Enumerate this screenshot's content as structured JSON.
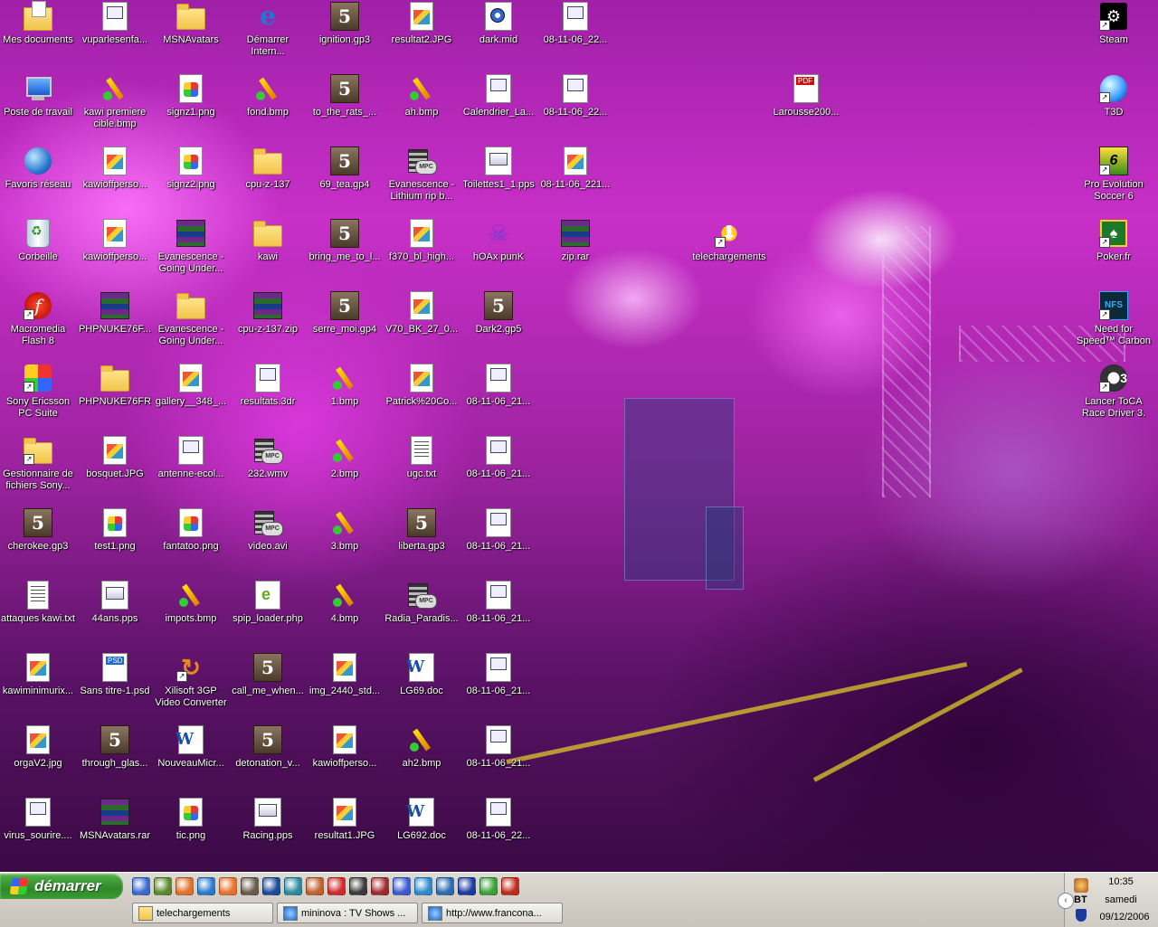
{
  "desktop": {
    "icons": [
      {
        "label": "Mes documents",
        "icon": "my-documents-icon",
        "kind": "mydocs"
      },
      {
        "label": "Poste de travail",
        "icon": "my-computer-icon",
        "kind": "computer"
      },
      {
        "label": "Favoris réseau",
        "icon": "network-places-icon",
        "kind": "network"
      },
      {
        "label": "Corbeille",
        "icon": "recycle-bin-icon",
        "kind": "bin"
      },
      {
        "label": "Macromedia Flash 8",
        "icon": "flash-icon",
        "kind": "flash",
        "shortcut": true
      },
      {
        "label": "Sony Ericsson PC Suite",
        "icon": "sony-ericsson-icon",
        "kind": "sonyeric",
        "shortcut": true
      },
      {
        "label": "Gestionnaire de fichiers Sony...",
        "icon": "folder-icon",
        "kind": "folder",
        "shortcut": true
      },
      {
        "label": "cherokee.gp3",
        "icon": "guitar-pro-icon",
        "kind": "gp3"
      },
      {
        "label": "attaques kawi.txt",
        "icon": "text-file-icon",
        "kind": "txt"
      },
      {
        "label": "kawiminimurix...",
        "icon": "image-file-icon",
        "kind": "img"
      },
      {
        "label": "orgaV2.jpg",
        "icon": "image-file-icon",
        "kind": "img"
      },
      {
        "label": "virus_sourire....",
        "icon": "web-file-icon",
        "kind": "web"
      },
      {
        "label": "vuparlesenfa...",
        "icon": "web-file-icon",
        "kind": "web"
      },
      {
        "label": "kawi premiere cible.bmp",
        "icon": "bitmap-icon",
        "kind": "bmp"
      },
      {
        "label": "kawioffperso...",
        "icon": "image-file-icon",
        "kind": "img"
      },
      {
        "label": "kawioffperso...",
        "icon": "image-file-icon",
        "kind": "img"
      },
      {
        "label": "PHPNUKE76F...",
        "icon": "rar-archive-icon",
        "kind": "rar"
      },
      {
        "label": "PHPNUKE76FR",
        "icon": "folder-icon",
        "kind": "folder"
      },
      {
        "label": "bosquet.JPG",
        "icon": "image-file-icon",
        "kind": "img"
      },
      {
        "label": "test1.png",
        "icon": "png-file-icon",
        "kind": "png"
      },
      {
        "label": "44ans.pps",
        "icon": "slideshow-icon",
        "kind": "pps"
      },
      {
        "label": "Sans titre-1.psd",
        "icon": "psd-file-icon",
        "kind": "psd"
      },
      {
        "label": "through_glas...",
        "icon": "guitar-pro-icon",
        "kind": "gp3"
      },
      {
        "label": "MSNAvatars.rar",
        "icon": "rar-archive-icon",
        "kind": "rar"
      },
      {
        "label": "MSNAvatars",
        "icon": "folder-icon",
        "kind": "folder"
      },
      {
        "label": "signz1.png",
        "icon": "png-file-icon",
        "kind": "png"
      },
      {
        "label": "signz2.png",
        "icon": "png-file-icon",
        "kind": "png"
      },
      {
        "label": "Evanescence - Going Under...",
        "icon": "rar-archive-icon",
        "kind": "rar"
      },
      {
        "label": "Evanescence - Going Under...",
        "icon": "folder-icon",
        "kind": "folder"
      },
      {
        "label": "gallery__348_...",
        "icon": "image-file-icon",
        "kind": "img"
      },
      {
        "label": "antenne-ecol...",
        "icon": "web-file-icon",
        "kind": "web"
      },
      {
        "label": "fantatoo.png",
        "icon": "png-file-icon",
        "kind": "png"
      },
      {
        "label": "impots.bmp",
        "icon": "bitmap-icon",
        "kind": "bmp"
      },
      {
        "label": "Xilisoft 3GP Video Converter",
        "icon": "xilisoft-icon",
        "kind": "xili",
        "shortcut": true
      },
      {
        "label": "NouveauMicr...",
        "icon": "word-document-icon",
        "kind": "word"
      },
      {
        "label": "tic.png",
        "icon": "png-file-icon",
        "kind": "png"
      },
      {
        "label": "Démarrer Intern...",
        "icon": "internet-explorer-icon",
        "kind": "ie"
      },
      {
        "label": "fond.bmp",
        "icon": "bitmap-icon",
        "kind": "bmp"
      },
      {
        "label": "cpu-z-137",
        "icon": "folder-icon",
        "kind": "folder"
      },
      {
        "label": "kawi",
        "icon": "folder-icon",
        "kind": "folder"
      },
      {
        "label": "cpu-z-137.zip",
        "icon": "rar-archive-icon",
        "kind": "rar"
      },
      {
        "label": "resultats.3dr",
        "icon": "web-file-icon",
        "kind": "web"
      },
      {
        "label": "232.wmv",
        "icon": "video-file-icon",
        "kind": "video"
      },
      {
        "label": "video.avi",
        "icon": "video-file-icon",
        "kind": "video"
      },
      {
        "label": "spip_loader.php",
        "icon": "php-file-icon",
        "kind": "php"
      },
      {
        "label": "call_me_when...",
        "icon": "guitar-pro-icon",
        "kind": "gp3"
      },
      {
        "label": "detonation_v...",
        "icon": "guitar-pro-icon",
        "kind": "gp3"
      },
      {
        "label": "Racing.pps",
        "icon": "slideshow-icon",
        "kind": "pps"
      },
      {
        "label": "ignition.gp3",
        "icon": "guitar-pro-icon",
        "kind": "gp3"
      },
      {
        "label": "to_the_rats_...",
        "icon": "guitar-pro-icon",
        "kind": "gp3"
      },
      {
        "label": "69_tea.gp4",
        "icon": "guitar-pro-icon",
        "kind": "gp3"
      },
      {
        "label": "bring_me_to_l...",
        "icon": "guitar-pro-icon",
        "kind": "gp3"
      },
      {
        "label": "serre_moi.gp4",
        "icon": "guitar-pro-icon",
        "kind": "gp3"
      },
      {
        "label": "1.bmp",
        "icon": "bitmap-icon",
        "kind": "bmp"
      },
      {
        "label": "2.bmp",
        "icon": "bitmap-icon",
        "kind": "bmp"
      },
      {
        "label": "3.bmp",
        "icon": "bitmap-icon",
        "kind": "bmp"
      },
      {
        "label": "4.bmp",
        "icon": "bitmap-icon",
        "kind": "bmp"
      },
      {
        "label": "img_2440_std...",
        "icon": "image-file-icon",
        "kind": "img"
      },
      {
        "label": "kawioffperso...",
        "icon": "image-file-icon",
        "kind": "img"
      },
      {
        "label": "resultat1.JPG",
        "icon": "image-file-icon",
        "kind": "img"
      },
      {
        "label": "resultat2.JPG",
        "icon": "image-file-icon",
        "kind": "img"
      },
      {
        "label": "ah.bmp",
        "icon": "bitmap-icon",
        "kind": "bmp"
      },
      {
        "label": "Evanescence - Lithium rip b...",
        "icon": "video-file-icon",
        "kind": "video"
      },
      {
        "label": "f370_bl_high...",
        "icon": "image-file-icon",
        "kind": "img"
      },
      {
        "label": "V70_BK_27_0...",
        "icon": "image-file-icon",
        "kind": "img"
      },
      {
        "label": "Patrick%20Co...",
        "icon": "image-file-icon",
        "kind": "img"
      },
      {
        "label": "ugc.txt",
        "icon": "text-file-icon",
        "kind": "txt"
      },
      {
        "label": "liberta.gp3",
        "icon": "guitar-pro-icon",
        "kind": "gp3"
      },
      {
        "label": "Radia_Paradis...",
        "icon": "video-file-icon",
        "kind": "video"
      },
      {
        "label": "LG69.doc",
        "icon": "word-document-icon",
        "kind": "word"
      },
      {
        "label": "ah2.bmp",
        "icon": "bitmap-icon",
        "kind": "bmp"
      },
      {
        "label": "LG692.doc",
        "icon": "word-document-icon",
        "kind": "word"
      },
      {
        "label": "dark.mid",
        "icon": "midi-file-icon",
        "kind": "mid"
      },
      {
        "label": "Calendrier_La...",
        "icon": "web-file-icon",
        "kind": "web"
      },
      {
        "label": "Toilettes1_1.pps",
        "icon": "slideshow-icon",
        "kind": "pps"
      },
      {
        "label": "hOAx punK",
        "icon": "spider-icon",
        "kind": "ghost"
      },
      {
        "label": "Dark2.gp5",
        "icon": "guitar-pro-icon",
        "kind": "gp3"
      },
      {
        "label": "08-11-06_21...",
        "icon": "web-page-icon",
        "kind": "web"
      },
      {
        "label": "08-11-06_21...",
        "icon": "web-page-icon",
        "kind": "web"
      },
      {
        "label": "08-11-06_21...",
        "icon": "web-page-icon",
        "kind": "web"
      },
      {
        "label": "08-11-06_21...",
        "icon": "web-page-icon",
        "kind": "web"
      },
      {
        "label": "08-11-06_21...",
        "icon": "web-page-icon",
        "kind": "web"
      },
      {
        "label": "08-11-06_21...",
        "icon": "web-page-icon",
        "kind": "web"
      },
      {
        "label": "08-11-06_22...",
        "icon": "web-page-icon",
        "kind": "web"
      },
      {
        "label": "08-11-06_22...",
        "icon": "web-page-icon",
        "kind": "web"
      },
      {
        "label": "08-11-06_22...",
        "icon": "web-page-icon",
        "kind": "web"
      },
      {
        "label": "08-11-06_221...",
        "icon": "image-file-icon",
        "kind": "img"
      },
      {
        "label": "zip.rar",
        "icon": "rar-archive-icon",
        "kind": "rar"
      },
      {
        "label": "Larousse200...",
        "icon": "pdf-file-icon",
        "kind": "pdf"
      },
      {
        "label": "telechargements",
        "icon": "downloads-folder-icon",
        "kind": "teleg",
        "shortcut": true
      },
      {
        "label": "Steam",
        "icon": "steam-icon",
        "kind": "steam",
        "shortcut": true
      },
      {
        "label": "T3D",
        "icon": "t3d-icon",
        "kind": "t3d",
        "shortcut": true
      },
      {
        "label": "Pro Evolution Soccer 6",
        "icon": "pes6-icon",
        "kind": "game",
        "shortcut": true
      },
      {
        "label": "Poker.fr",
        "icon": "poker-icon",
        "kind": "poker",
        "shortcut": true
      },
      {
        "label": "Need for Speed™ Carbon",
        "icon": "nfs-carbon-icon",
        "kind": "nfs",
        "shortcut": true
      },
      {
        "label": "Lancer ToCA Race Driver 3.",
        "icon": "toca-icon",
        "kind": "toca",
        "shortcut": true
      }
    ]
  },
  "taskbar": {
    "start_label": "démarrer",
    "quick_launch": [
      {
        "icon": "show-desktop-icon",
        "color": "#3a6ad0"
      },
      {
        "icon": "winamp-icon",
        "color": "#5a8a2a"
      },
      {
        "icon": "firefox-icon",
        "color": "#e0702a"
      },
      {
        "icon": "internet-explorer-icon",
        "color": "#2a7ad0"
      },
      {
        "icon": "messenger-icon",
        "color": "#e8702a"
      },
      {
        "icon": "guitar-pro-icon",
        "color": "#6a5a4a"
      },
      {
        "icon": "media-player-icon",
        "color": "#1a4a9a"
      },
      {
        "icon": "paint-icon",
        "color": "#2a8aa0"
      },
      {
        "icon": "xilisoft-icon",
        "color": "#c0602a"
      },
      {
        "icon": "vlc-icon",
        "color": "#d02a2a"
      },
      {
        "icon": "flag-icon",
        "color": "#3a3a3a"
      },
      {
        "icon": "nero-icon",
        "color": "#a02a2a"
      },
      {
        "icon": "network-icon",
        "color": "#3a5ad0"
      },
      {
        "icon": "emule-icon",
        "color": "#2a8ad0"
      },
      {
        "icon": "search-icon",
        "color": "#2a6ab0"
      },
      {
        "icon": "steam-icon",
        "color": "#1a3aa0"
      },
      {
        "icon": "msn-icon",
        "color": "#3aa03a"
      },
      {
        "icon": "filezilla-icon",
        "color": "#c02a1a"
      }
    ],
    "tasks": [
      {
        "label": "telechargements",
        "icon": "folder-icon"
      },
      {
        "label": "mininova : TV Shows ...",
        "icon": "internet-explorer-icon"
      },
      {
        "label": "http://www.franconа...",
        "icon": "internet-explorer-icon"
      }
    ],
    "tray": {
      "time": "10:35",
      "day": "samedi",
      "date": "09/12/2006",
      "language": "BT"
    }
  },
  "colors": {
    "start_green": "#3a9a32",
    "taskbar_bg": "#d4d0c8"
  }
}
